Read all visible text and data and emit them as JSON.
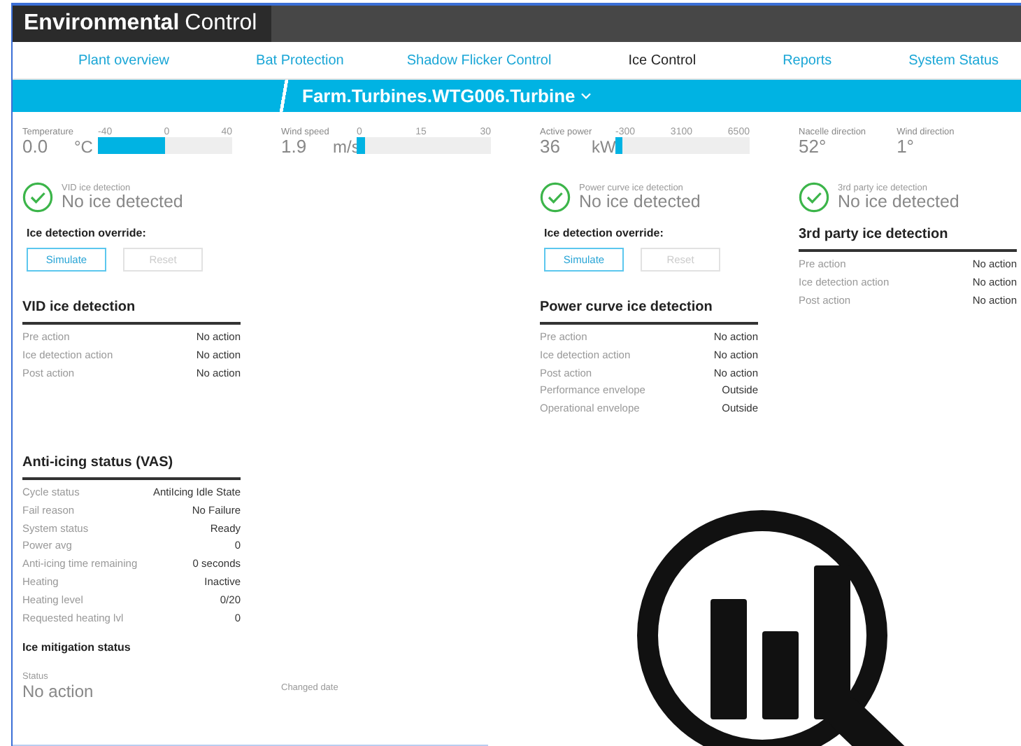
{
  "app_title": {
    "bold": "Environmental",
    "regular": "Control"
  },
  "nav": [
    {
      "label": "Plant overview",
      "selected": false
    },
    {
      "label": "Bat Protection",
      "selected": false
    },
    {
      "label": "Shadow Flicker Control",
      "selected": false
    },
    {
      "label": "Ice Control",
      "selected": true
    },
    {
      "label": "Reports",
      "selected": false
    },
    {
      "label": "System Status",
      "selected": false
    }
  ],
  "breadcrumb": "Farm.Turbines.WTG006.Turbine",
  "sensors": [
    {
      "kind": "gauge",
      "label": "Temperature",
      "value": "0.0",
      "unit": "°C",
      "ticks": [
        "-40",
        "0",
        "40"
      ],
      "level": 0.5
    },
    {
      "kind": "gauge",
      "label": "Wind speed",
      "value": "1.9",
      "unit": "m/s",
      "ticks": [
        "0",
        "15",
        "30"
      ],
      "level": 0.06
    },
    {
      "kind": "gauge",
      "label": "Active power",
      "value": "36",
      "unit": "kW",
      "ticks": [
        "-300",
        "3100",
        "6500"
      ],
      "level": 0.05
    },
    {
      "kind": "readouts",
      "items": [
        {
          "label": "Nacelle direction",
          "value": "52°"
        },
        {
          "label": "Wind direction",
          "value": "1°"
        }
      ]
    }
  ],
  "panels": [
    {
      "detector": "VID ice detection",
      "status": "No ice detected",
      "ok": true,
      "override": {
        "label": "Ice detection override:",
        "buttons": [
          {
            "label": "Simulate",
            "disabled": false
          },
          {
            "label": "Reset",
            "disabled": true
          }
        ]
      },
      "table": {
        "title": "VID ice detection",
        "rows": [
          {
            "label": "Pre action",
            "value": "No action"
          },
          {
            "label": "Ice detection action",
            "value": "No action"
          },
          {
            "label": "Post action",
            "value": "No action"
          }
        ]
      }
    },
    {
      "detector": "Power curve ice detection",
      "status": "No ice detected",
      "ok": true,
      "override": {
        "label": "Ice detection override:",
        "buttons": [
          {
            "label": "Simulate",
            "disabled": false
          },
          {
            "label": "Reset",
            "disabled": true
          }
        ]
      },
      "table": {
        "title": "Power curve ice detection",
        "rows": [
          {
            "label": "Pre action",
            "value": "No action"
          },
          {
            "label": "Ice detection action",
            "value": "No action"
          },
          {
            "label": "Post action",
            "value": "No action"
          },
          {
            "label": "Performance envelope",
            "value": "Outside"
          },
          {
            "label": "Operational envelope",
            "value": "Outside"
          }
        ]
      }
    },
    {
      "detector": "3rd party ice detection",
      "status": "No ice detected",
      "ok": true,
      "table": {
        "title": "3rd party ice detection",
        "rows": [
          {
            "label": "Pre action",
            "value": "No action"
          },
          {
            "label": "Ice detection action",
            "value": "No action"
          },
          {
            "label": "Post action",
            "value": "No action"
          }
        ]
      }
    }
  ],
  "anti_icing": {
    "title": "Anti-icing status (VAS)",
    "rows": [
      {
        "label": "Cycle status",
        "value": "AntiIcing Idle State"
      },
      {
        "label": "Fail reason",
        "value": "No Failure"
      },
      {
        "label": "System status",
        "value": "Ready"
      },
      {
        "label": "Power avg",
        "value": "0"
      },
      {
        "label": "Anti-icing time remaining",
        "value": "0 seconds"
      },
      {
        "label": "Heating",
        "value": "Inactive"
      },
      {
        "label": "Heating level",
        "value": "0/20"
      },
      {
        "label": "Requested heating lvl",
        "value": "0"
      }
    ]
  },
  "ice_mitigation": {
    "title": "Ice mitigation status",
    "status_label": "Status",
    "status_value": "No action",
    "changed_label": "Changed date"
  }
}
